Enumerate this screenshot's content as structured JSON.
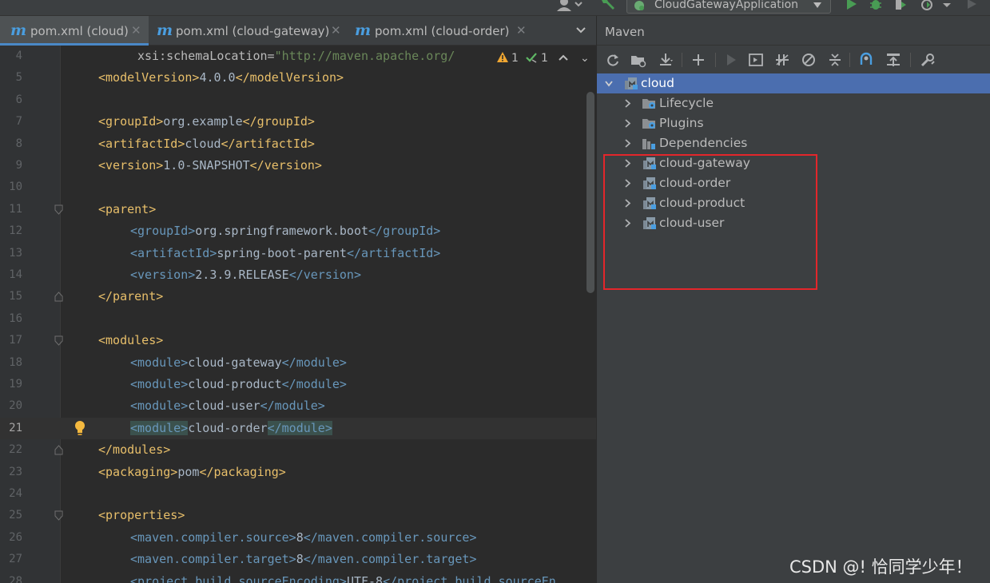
{
  "toolbar": {
    "run_config_label": "CloudGatewayApplication"
  },
  "editor_tabs": [
    {
      "label": "pom.xml (cloud)",
      "active": true
    },
    {
      "label": "pom.xml (cloud-gateway)",
      "active": false
    },
    {
      "label": "pom.xml (cloud-order)",
      "active": false
    }
  ],
  "inspection": {
    "warnings": "1",
    "weak_warnings": "1"
  },
  "editor": {
    "current_line": 21,
    "lines": [
      {
        "n": "4",
        "indent": 2,
        "parts": [
          [
            "xattr",
            "xsi:schemaLocation="
          ],
          [
            "xval",
            "\"http://maven.apache.org/"
          ]
        ]
      },
      {
        "n": "5",
        "indent": 0,
        "parts": [
          [
            "tag",
            "<modelVersion>"
          ],
          [
            "txt",
            "4.0.0"
          ],
          [
            "tag",
            "</modelVersion>"
          ]
        ]
      },
      {
        "n": "6",
        "indent": 0,
        "parts": []
      },
      {
        "n": "7",
        "indent": 0,
        "parts": [
          [
            "tag",
            "<groupId>"
          ],
          [
            "txt",
            "org.example"
          ],
          [
            "tag",
            "</groupId>"
          ]
        ]
      },
      {
        "n": "8",
        "indent": 0,
        "parts": [
          [
            "tag",
            "<artifactId>"
          ],
          [
            "txt",
            "cloud"
          ],
          [
            "tag",
            "</artifactId>"
          ]
        ]
      },
      {
        "n": "9",
        "indent": 0,
        "parts": [
          [
            "tag",
            "<version>"
          ],
          [
            "txt",
            "1.0-SNAPSHOT"
          ],
          [
            "tag",
            "</version>"
          ]
        ]
      },
      {
        "n": "10",
        "indent": 0,
        "parts": []
      },
      {
        "n": "11",
        "indent": 0,
        "parts": [
          [
            "tag",
            "<parent>"
          ]
        ]
      },
      {
        "n": "12",
        "indent": 1,
        "parts": [
          [
            "xtag",
            "<groupId>"
          ],
          [
            "txt",
            "org.springframework.boot"
          ],
          [
            "xtag",
            "</groupId>"
          ]
        ]
      },
      {
        "n": "13",
        "indent": 1,
        "parts": [
          [
            "xtag",
            "<artifactId>"
          ],
          [
            "txt",
            "spring-boot-parent"
          ],
          [
            "xtag",
            "</artifactId>"
          ]
        ]
      },
      {
        "n": "14",
        "indent": 1,
        "parts": [
          [
            "xtag",
            "<version>"
          ],
          [
            "txt",
            "2.3.9.RELEASE"
          ],
          [
            "xtag",
            "</version>"
          ]
        ]
      },
      {
        "n": "15",
        "indent": 0,
        "parts": [
          [
            "tag",
            "</parent>"
          ]
        ]
      },
      {
        "n": "16",
        "indent": 0,
        "parts": []
      },
      {
        "n": "17",
        "indent": 0,
        "parts": [
          [
            "tag",
            "<modules>"
          ]
        ]
      },
      {
        "n": "18",
        "indent": 1,
        "parts": [
          [
            "xtag",
            "<module>"
          ],
          [
            "txt",
            "cloud-gateway"
          ],
          [
            "xtag",
            "</module>"
          ]
        ]
      },
      {
        "n": "19",
        "indent": 1,
        "parts": [
          [
            "xtag",
            "<module>"
          ],
          [
            "txt",
            "cloud-product"
          ],
          [
            "xtag",
            "</module>"
          ]
        ]
      },
      {
        "n": "20",
        "indent": 1,
        "parts": [
          [
            "xtag",
            "<module>"
          ],
          [
            "txt",
            "cloud-user"
          ],
          [
            "xtag",
            "</module>"
          ]
        ]
      },
      {
        "n": "21",
        "indent": 1,
        "parts": [
          [
            "xtag hl",
            "<module>"
          ],
          [
            "txt",
            "cloud-order"
          ],
          [
            "xtag hl",
            "</module>"
          ]
        ]
      },
      {
        "n": "22",
        "indent": 0,
        "parts": [
          [
            "tag",
            "</modules>"
          ]
        ]
      },
      {
        "n": "23",
        "indent": 0,
        "parts": [
          [
            "tag",
            "<packaging>"
          ],
          [
            "txt",
            "pom"
          ],
          [
            "tag",
            "</packaging>"
          ]
        ]
      },
      {
        "n": "24",
        "indent": 0,
        "parts": []
      },
      {
        "n": "25",
        "indent": 0,
        "parts": [
          [
            "tag",
            "<properties>"
          ]
        ]
      },
      {
        "n": "26",
        "indent": 1,
        "parts": [
          [
            "xtag",
            "<maven.compiler.source>"
          ],
          [
            "txt",
            "8"
          ],
          [
            "xtag",
            "</maven.compiler.source>"
          ]
        ]
      },
      {
        "n": "27",
        "indent": 1,
        "parts": [
          [
            "xtag",
            "<maven.compiler.target>"
          ],
          [
            "txt",
            "8"
          ],
          [
            "xtag",
            "</maven.compiler.target>"
          ]
        ]
      },
      {
        "n": "28",
        "indent": 1,
        "parts": [
          [
            "xtag",
            "<project.build.sourceEncoding>"
          ],
          [
            "txt",
            "UTF-8"
          ],
          [
            "xtag",
            "</project.build.sourceEn"
          ]
        ]
      }
    ]
  },
  "maven": {
    "title": "Maven",
    "tree": [
      {
        "label": "cloud",
        "level": 0,
        "expanded": true,
        "selected": true,
        "icon": "maven-module-icon"
      },
      {
        "label": "Lifecycle",
        "level": 1,
        "icon": "lifecycle-icon"
      },
      {
        "label": "Plugins",
        "level": 1,
        "icon": "plugins-icon"
      },
      {
        "label": "Dependencies",
        "level": 1,
        "icon": "dependencies-icon"
      },
      {
        "label": "cloud-gateway",
        "level": 1,
        "icon": "maven-module-icon"
      },
      {
        "label": "cloud-order",
        "level": 1,
        "icon": "maven-module-icon"
      },
      {
        "label": "cloud-product",
        "level": 1,
        "icon": "maven-module-icon"
      },
      {
        "label": "cloud-user",
        "level": 1,
        "icon": "maven-module-icon"
      }
    ]
  },
  "watermark": "CSDN @! 恰同学少年！",
  "colors": {
    "editor_bg": "#2b2b2b",
    "panel_bg": "#3c3f41",
    "selection": "#4b6eaf",
    "xml_tag": "#e8bf6a",
    "xml_nested_tag": "#6897bb",
    "string": "#6a8759",
    "annotation_box": "#e3262b",
    "run_green": "#499c54"
  }
}
